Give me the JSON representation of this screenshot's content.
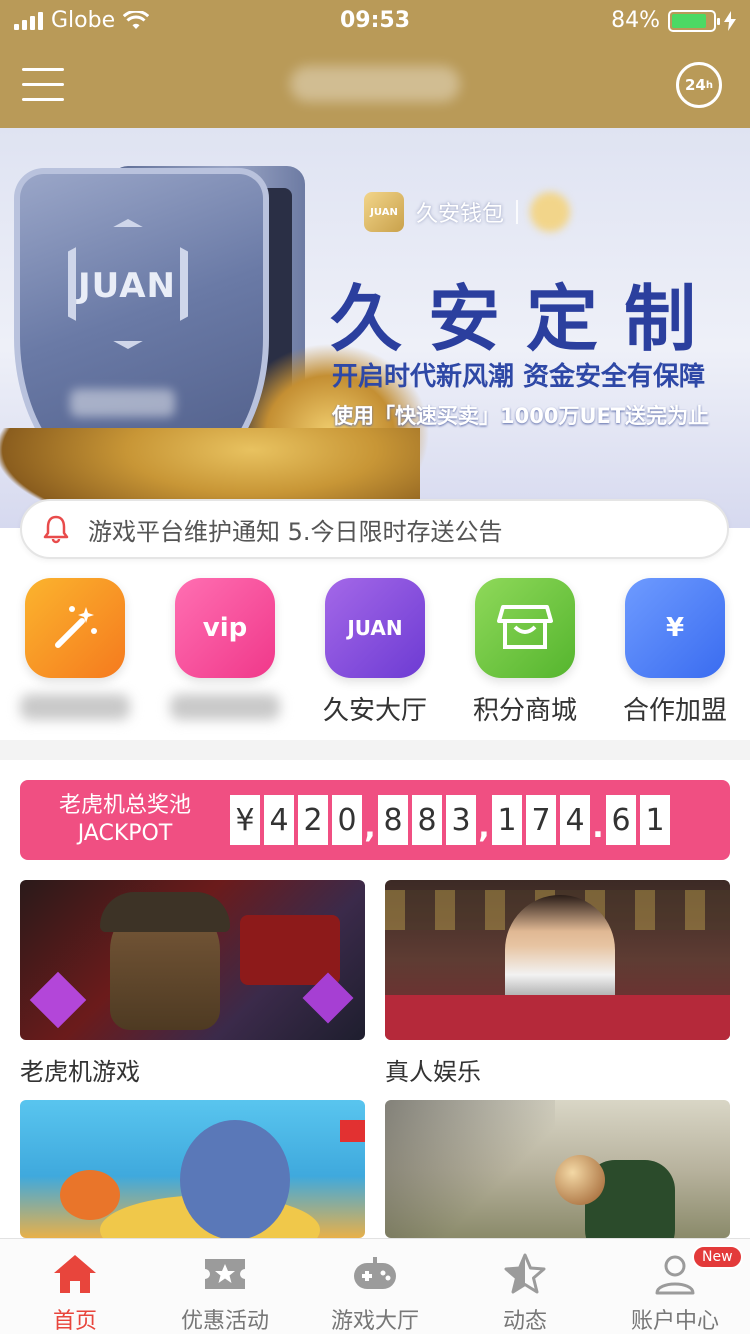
{
  "status_bar": {
    "carrier": "Globe",
    "time": "09:53",
    "battery": "84%",
    "battery_level": 0.84
  },
  "header": {
    "title": "",
    "support_label": "24",
    "support_label_sup": "h"
  },
  "banner": {
    "brand_logo_text": "JUAN",
    "brand_name": "久安钱包",
    "title": "久安定制",
    "subtitle": "开启时代新风潮 资金安全有保障",
    "note": "使用「快速买卖」1000万UET送完为止",
    "shield_text": "JUAN"
  },
  "notice": {
    "text": "游戏平台维护通知 5.今日限时存送公告"
  },
  "quick_items": [
    {
      "label": "",
      "icon": "magic-wand-icon",
      "color_from": "#fbb42e",
      "color_to": "#f57a1e"
    },
    {
      "label": "",
      "icon": "vip-crown-icon",
      "icon_text": "vip",
      "color_from": "#ff6fb2",
      "color_to": "#f0388a"
    },
    {
      "label": "久安大厅",
      "icon": "juan-logo-icon",
      "icon_text": "JUAN",
      "color_from": "#a468e8",
      "color_to": "#6d3bd3"
    },
    {
      "label": "积分商城",
      "icon": "store-icon",
      "color_from": "#8fd95a",
      "color_to": "#55b52e"
    },
    {
      "label": "合作加盟",
      "icon": "money-bag-icon",
      "icon_text": "¥",
      "color_from": "#6e9bff",
      "color_to": "#3a6cf0"
    }
  ],
  "jackpot": {
    "label_line1": "老虎机总奖池",
    "label_line2": "JACKPOT",
    "amount": "¥420,883,174.61",
    "color": "#f04f82"
  },
  "games": [
    {
      "label": "老虎机游戏",
      "image": "slot-machine-art"
    },
    {
      "label": "真人娱乐",
      "image": "live-dealer-photo"
    },
    {
      "label": "",
      "image": "fishing-game-art"
    },
    {
      "label": "",
      "image": "football-photo"
    }
  ],
  "tabbar": {
    "items": [
      {
        "label": "首页",
        "icon": "home-icon",
        "active": true
      },
      {
        "label": "优惠活动",
        "icon": "ticket-star-icon"
      },
      {
        "label": "游戏大厅",
        "icon": "gamepad-icon"
      },
      {
        "label": "动态",
        "icon": "star-icon"
      },
      {
        "label": "账户中心",
        "icon": "user-icon",
        "badge": "New"
      }
    ],
    "active_color": "#e8453c"
  }
}
